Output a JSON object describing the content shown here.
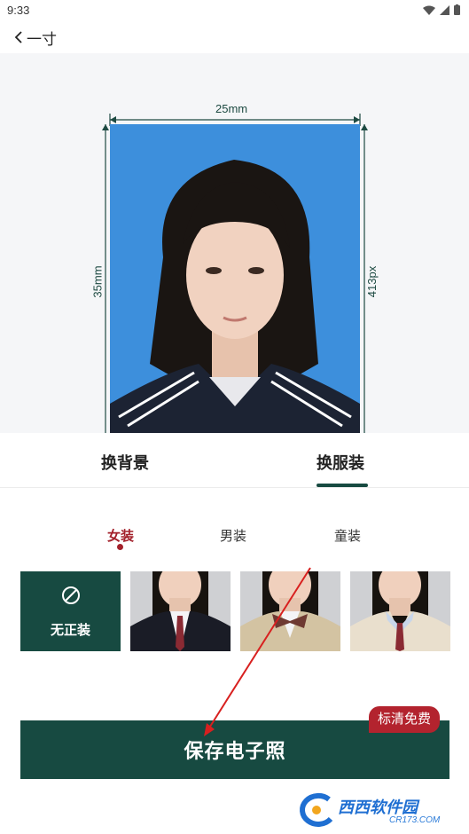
{
  "status": {
    "time": "9:33"
  },
  "nav": {
    "title": "一寸"
  },
  "preview": {
    "width_label": "25mm",
    "height_label": "35mm",
    "px_label": "413px",
    "background_color": "#3d8fdc"
  },
  "tabs": [
    {
      "label": "换背景",
      "active": false
    },
    {
      "label": "换服装",
      "active": true
    }
  ],
  "subtabs": [
    {
      "label": "女装",
      "active": true
    },
    {
      "label": "男装",
      "active": false
    },
    {
      "label": "童装",
      "active": false
    }
  ],
  "outfits": {
    "none_label": "无正装"
  },
  "save": {
    "label": "保存电子照",
    "badge": "标清免费"
  },
  "watermark": {
    "text": "西西软件园",
    "url": "CR173.COM"
  },
  "colors": {
    "accent": "#174a41",
    "badge": "#b3232e",
    "active_subtab": "#a3212b"
  }
}
